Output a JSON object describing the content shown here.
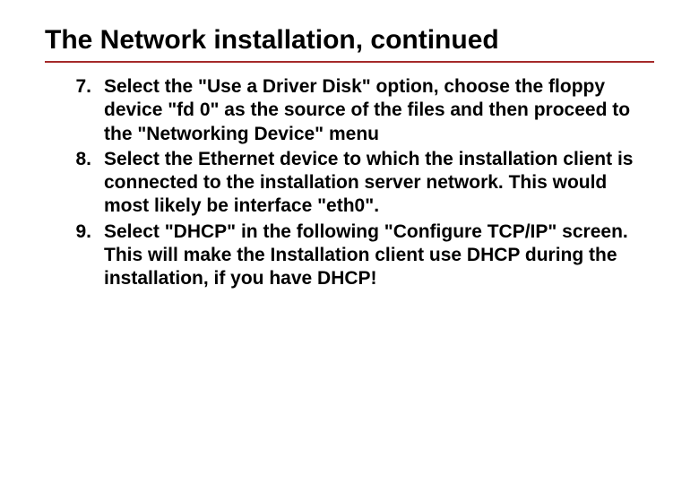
{
  "title": "The Network installation, continued",
  "items": [
    {
      "number": "7.",
      "text": "Select the \"Use a Driver Disk\" option, choose the floppy device \"fd 0\" as the source of the files and then proceed to the \"Networking Device\" menu"
    },
    {
      "number": "8.",
      "text": "Select the Ethernet device to which the installation client is connected to the installation server network. This would most likely be interface \"eth0\"."
    },
    {
      "number": "9.",
      "text": "Select \"DHCP\" in the following \"Configure TCP/IP\" screen. This will make the Installation client use DHCP during the installation, if you have DHCP!"
    }
  ]
}
